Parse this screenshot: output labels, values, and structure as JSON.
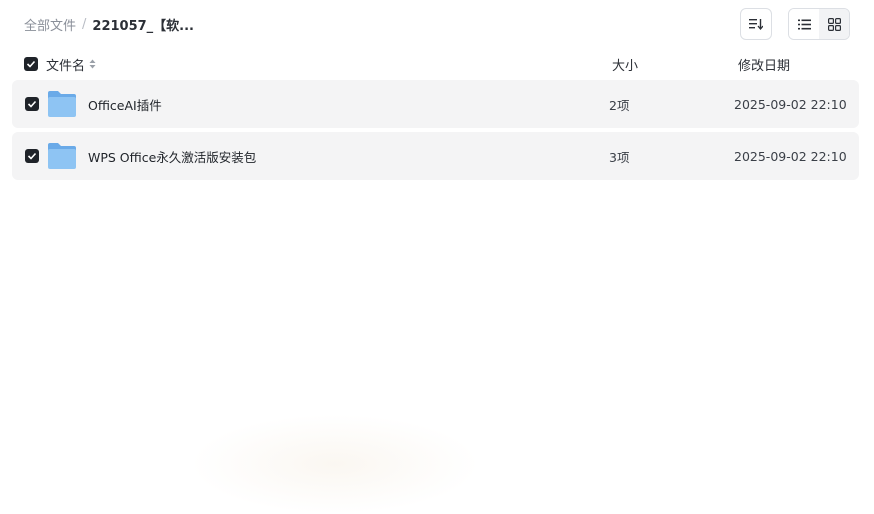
{
  "breadcrumb": {
    "root": "全部文件",
    "separator": "/",
    "current": "221057_【软..."
  },
  "toolbar": {
    "sort_icon": "sort-icon",
    "list_view_icon": "list-view-icon",
    "grid_view_icon": "grid-view-icon",
    "active_view": "list"
  },
  "header": {
    "name": "文件名",
    "size": "大小",
    "date": "修改日期"
  },
  "files": [
    {
      "name": "OfficeAI插件",
      "size": "2项",
      "date": "2025-09-02 22:10",
      "type": "folder",
      "checked": true
    },
    {
      "name": "WPS Office永久激活版安装包",
      "size": "3项",
      "date": "2025-09-02 22:10",
      "type": "folder",
      "checked": true
    }
  ],
  "colors": {
    "row_bg": "#f4f4f5",
    "checkbox": "#1f2329",
    "folder": "#7db7ee"
  }
}
